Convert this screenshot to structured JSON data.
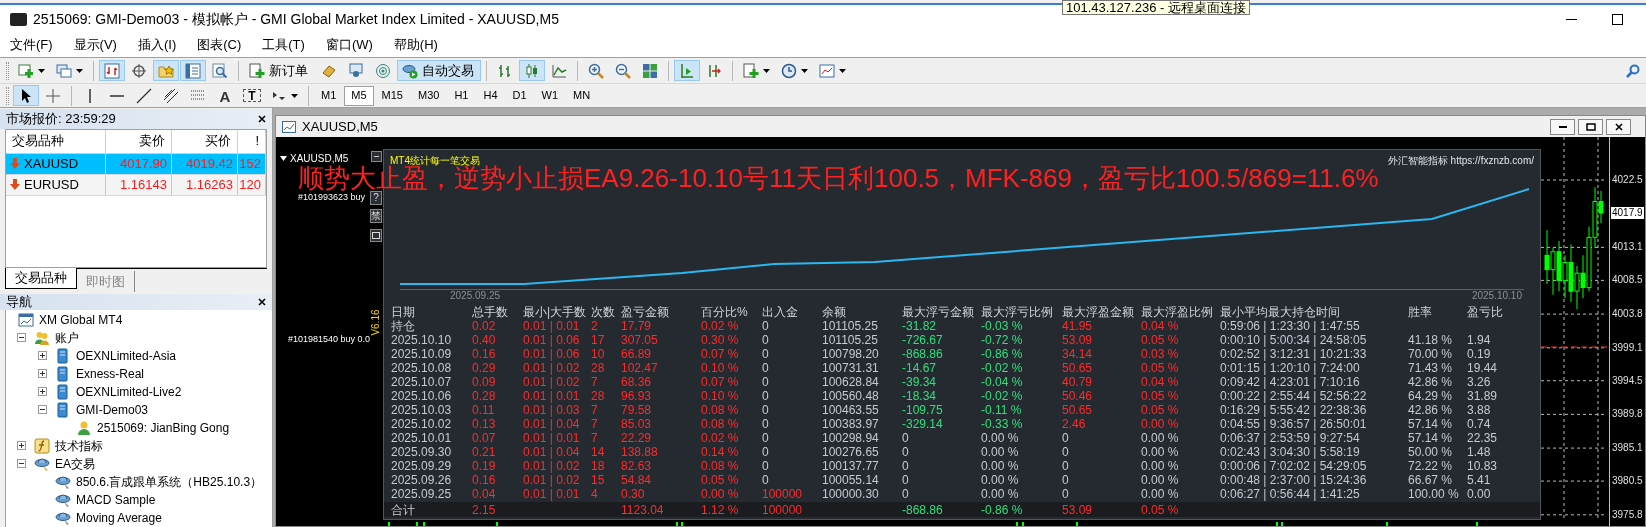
{
  "window": {
    "title": "2515069: GMI-Demo03 - 模拟帐户 - GMI Global Market Index Limited - XAUUSD,M5"
  },
  "tooltip": "101.43.127.236 - 远程桌面连接",
  "menu": [
    "文件(F)",
    "显示(V)",
    "插入(I)",
    "图表(C)",
    "工具(T)",
    "窗口(W)",
    "帮助(H)"
  ],
  "toolbars": [
    [
      {
        "kind": "new-chart",
        "pressed": false
      },
      {
        "kind": "profiles",
        "pressed": false
      },
      {
        "kind": "separator"
      },
      {
        "kind": "market-watch",
        "pressed": true
      },
      {
        "kind": "data-window",
        "pressed": false
      },
      {
        "kind": "navigator",
        "pressed": true
      },
      {
        "kind": "terminal",
        "pressed": true
      },
      {
        "kind": "tester",
        "pressed": false
      },
      {
        "kind": "separator"
      },
      {
        "kind": "order",
        "label": "新订单",
        "pressed": false
      },
      {
        "kind": "editor",
        "pressed": false
      },
      {
        "kind": "news",
        "pressed": false
      },
      {
        "kind": "signals",
        "pressed": false
      },
      {
        "kind": "autotrade",
        "label": "自动交易",
        "pressed": true
      },
      {
        "kind": "separator"
      },
      {
        "kind": "bar-chart",
        "pressed": false
      },
      {
        "kind": "candles",
        "pressed": true
      },
      {
        "kind": "line-chart",
        "pressed": false
      },
      {
        "kind": "separator"
      },
      {
        "kind": "zoom-in",
        "pressed": false
      },
      {
        "kind": "zoom-out",
        "pressed": false
      },
      {
        "kind": "tile",
        "pressed": false
      },
      {
        "kind": "separator"
      },
      {
        "kind": "autoscroll",
        "pressed": true
      },
      {
        "kind": "shift",
        "pressed": false
      },
      {
        "kind": "separator"
      },
      {
        "kind": "indicators",
        "pressed": false
      },
      {
        "kind": "periods",
        "pressed": false
      },
      {
        "kind": "templates",
        "pressed": false
      }
    ],
    [
      {
        "kind": "cursor",
        "pressed": true
      },
      {
        "kind": "crosshair",
        "pressed": false
      },
      {
        "kind": "separator"
      },
      {
        "kind": "vline",
        "pressed": false
      },
      {
        "kind": "hline",
        "pressed": false
      },
      {
        "kind": "trendline",
        "pressed": false
      },
      {
        "kind": "channel",
        "pressed": false
      },
      {
        "kind": "fibo",
        "pressed": false
      },
      {
        "kind": "text",
        "label": "A",
        "pressed": false
      },
      {
        "kind": "label",
        "label": "T",
        "pressed": false
      },
      {
        "kind": "arrows",
        "pressed": false
      },
      {
        "kind": "separator"
      },
      {
        "kind": "period",
        "label": "M1",
        "pressed": false
      },
      {
        "kind": "period",
        "label": "M5",
        "pressed": true
      },
      {
        "kind": "period",
        "label": "M15",
        "pressed": false
      },
      {
        "kind": "period",
        "label": "M30",
        "pressed": false
      },
      {
        "kind": "period",
        "label": "H1",
        "pressed": false
      },
      {
        "kind": "period",
        "label": "H4",
        "pressed": false
      },
      {
        "kind": "period",
        "label": "D1",
        "pressed": false
      },
      {
        "kind": "period",
        "label": "W1",
        "pressed": false
      },
      {
        "kind": "period",
        "label": "MN",
        "pressed": false
      }
    ]
  ],
  "market_watch": {
    "title": "市场报价: 23:59:29",
    "columns": [
      "交易品种",
      "卖价",
      "买价",
      "!"
    ],
    "rows": [
      {
        "symbol": "XAUUSD",
        "bid": "4017.90",
        "ask": "4019.42",
        "spread": "152",
        "selected": true
      },
      {
        "symbol": "EURUSD",
        "bid": "1.16143",
        "ask": "1.16263",
        "spread": "120",
        "selected": false
      }
    ],
    "tabs": [
      {
        "label": "交易品种",
        "selected": true
      },
      {
        "label": "即时图",
        "selected": false
      }
    ]
  },
  "navigator": {
    "title": "导航",
    "tree": [
      {
        "label": "XM Global MT4",
        "kind": "root",
        "children": [
          {
            "label": "账户",
            "kind": "accounts",
            "expanded": true,
            "children": [
              {
                "label": "OEXNLimited-Asia",
                "kind": "server",
                "expanded": false
              },
              {
                "label": "Exness-Real",
                "kind": "server",
                "expanded": false
              },
              {
                "label": "OEXNLimited-Live2",
                "kind": "server",
                "expanded": false
              },
              {
                "label": "GMI-Demo03",
                "kind": "server",
                "expanded": true,
                "children": [
                  {
                    "label": "2515069: JianBing Gong",
                    "kind": "user"
                  }
                ]
              }
            ]
          },
          {
            "label": "技术指标",
            "kind": "indicators",
            "expanded": false
          },
          {
            "label": "EA交易",
            "kind": "experts",
            "expanded": true,
            "children": [
              {
                "label": "850.6.盲成跟单系统（HB25.10.3）",
                "kind": "expert"
              },
              {
                "label": "MACD Sample",
                "kind": "expert"
              },
              {
                "label": "Moving Average",
                "kind": "expert"
              }
            ]
          }
        ]
      }
    ]
  },
  "chart_window": {
    "title": "XAUUSD,M5",
    "symbol_label": "XAUUSD,M5",
    "orders": [
      "#101993623 buy",
      "#101981540 buy 0.0"
    ],
    "side_buttons": [
      "?",
      "禁"
    ],
    "version": "V6.16",
    "note": "顺势大止盈，逆势小止损EA9.26-10.10号11天日利100.5，MFK-869，盈亏比100.5/869=11.6%",
    "current_price": "4017.9",
    "chart_data": {
      "type": "candlestick",
      "ohlc": [
        [
          4012.0,
          4015.5,
          4008.0,
          4010.0
        ],
        [
          4010.0,
          4013.0,
          4006.5,
          4012.5
        ],
        [
          4012.5,
          4014.0,
          4007.0,
          4008.5
        ],
        [
          4008.5,
          4012.0,
          4006.0,
          4011.0
        ],
        [
          4011.0,
          4013.5,
          4005.5,
          4007.0
        ],
        [
          4007.0,
          4010.5,
          4004.5,
          4009.5
        ],
        [
          4009.5,
          4012.0,
          4006.0,
          4007.5
        ],
        [
          4007.5,
          4016.0,
          4007.0,
          4014.5
        ],
        [
          4014.5,
          4021.5,
          4013.0,
          4019.5
        ],
        [
          4019.5,
          4021.0,
          4016.5,
          4017.9
        ]
      ],
      "ylim": [
        3974.1,
        4028.5
      ],
      "yticks": [
        {
          "value": 4022.5,
          "label": "4022.5"
        },
        {
          "value": 4013.1,
          "label": "4013.1"
        },
        {
          "value": 4008.5,
          "label": "4008.5"
        },
        {
          "value": 4003.8,
          "label": "4003.8"
        },
        {
          "value": 3999.1,
          "label": "3999.1"
        },
        {
          "value": 3994.5,
          "label": "3994.5"
        },
        {
          "value": 3989.8,
          "label": "3989.8"
        },
        {
          "value": 3985.1,
          "label": "3985.1"
        },
        {
          "value": 3980.5,
          "label": "3980.5"
        },
        {
          "value": 3975.8,
          "label": "3975.8"
        }
      ]
    }
  },
  "stats_panel": {
    "title": "MT4统计每一笔交易",
    "credit": "外汇智能指标 https://fxznzb.com/",
    "dates": [
      "2025.09.25",
      "2025.10.10"
    ],
    "columns": [
      "日期",
      "总手数",
      "最小|大手数",
      "次数",
      "盈亏金额",
      "百分比%",
      "出入金",
      "余额",
      "最大浮亏金额",
      "最大浮亏比例",
      "最大浮盈金额",
      "最大浮盈比例",
      "最小平均最大持仓时间",
      "胜率",
      "盈亏比"
    ],
    "rows": [
      [
        {
          "text": "持仓",
          "kind": "plain"
        },
        {
          "text": "0.02",
          "kind": "red"
        },
        {
          "text": "0.01 | 0.01",
          "kind": "red"
        },
        {
          "text": "2",
          "kind": "red"
        },
        {
          "text": "17.79",
          "kind": "red"
        },
        {
          "text": "0.02 %",
          "kind": "red"
        },
        {
          "text": "0",
          "kind": "plain"
        },
        {
          "text": "101105.25",
          "kind": "plain"
        },
        {
          "text": "-31.82",
          "kind": "green"
        },
        {
          "text": "-0.03 %",
          "kind": "green"
        },
        {
          "text": "41.95",
          "kind": "red"
        },
        {
          "text": "0.04 %",
          "kind": "red"
        },
        {
          "text": "0:59:06 | 1:23:30 | 1:47:55",
          "kind": "plain"
        }
      ],
      [
        {
          "text": "2025.10.10",
          "kind": "plain"
        },
        {
          "text": "0.40",
          "kind": "red"
        },
        {
          "text": "0.01 | 0.06",
          "kind": "red"
        },
        {
          "text": "17",
          "kind": "red"
        },
        {
          "text": "307.05",
          "kind": "red"
        },
        {
          "text": "0.30 %",
          "kind": "red"
        },
        {
          "text": "0",
          "kind": "plain"
        },
        {
          "text": "101105.25",
          "kind": "plain"
        },
        {
          "text": "-726.67",
          "kind": "green"
        },
        {
          "text": "-0.72 %",
          "kind": "green"
        },
        {
          "text": "53.09",
          "kind": "red"
        },
        {
          "text": "0.05 %",
          "kind": "red"
        },
        {
          "text": "0:00:10 | 5:00:34 | 24:58:05",
          "kind": "plain"
        },
        {
          "text": "41.18 %",
          "kind": "plain"
        },
        {
          "text": "1.94",
          "kind": "plain"
        }
      ],
      [
        {
          "text": "2025.10.09",
          "kind": "plain"
        },
        {
          "text": "0.16",
          "kind": "red"
        },
        {
          "text": "0.01 | 0.06",
          "kind": "red"
        },
        {
          "text": "10",
          "kind": "red"
        },
        {
          "text": "66.89",
          "kind": "red"
        },
        {
          "text": "0.07 %",
          "kind": "red"
        },
        {
          "text": "0",
          "kind": "plain"
        },
        {
          "text": "100798.20",
          "kind": "plain"
        },
        {
          "text": "-868.86",
          "kind": "green"
        },
        {
          "text": "-0.86 %",
          "kind": "green"
        },
        {
          "text": "34.14",
          "kind": "red"
        },
        {
          "text": "0.03 %",
          "kind": "red"
        },
        {
          "text": "0:02:52 | 3:12:31 | 10:21:33",
          "kind": "plain"
        },
        {
          "text": "70.00 %",
          "kind": "plain"
        },
        {
          "text": "0.19",
          "kind": "plain"
        }
      ],
      [
        {
          "text": "2025.10.08",
          "kind": "plain"
        },
        {
          "text": "0.29",
          "kind": "red"
        },
        {
          "text": "0.01 | 0.02",
          "kind": "red"
        },
        {
          "text": "28",
          "kind": "red"
        },
        {
          "text": "102.47",
          "kind": "red"
        },
        {
          "text": "0.10 %",
          "kind": "red"
        },
        {
          "text": "0",
          "kind": "plain"
        },
        {
          "text": "100731.31",
          "kind": "plain"
        },
        {
          "text": "-14.67",
          "kind": "green"
        },
        {
          "text": "-0.02 %",
          "kind": "green"
        },
        {
          "text": "50.65",
          "kind": "red"
        },
        {
          "text": "0.05 %",
          "kind": "red"
        },
        {
          "text": "0:01:15 | 1:20:10 | 7:24:00",
          "kind": "plain"
        },
        {
          "text": "71.43 %",
          "kind": "plain"
        },
        {
          "text": "19.44",
          "kind": "plain"
        }
      ],
      [
        {
          "text": "2025.10.07",
          "kind": "plain"
        },
        {
          "text": "0.09",
          "kind": "red"
        },
        {
          "text": "0.01 | 0.02",
          "kind": "red"
        },
        {
          "text": "7",
          "kind": "red"
        },
        {
          "text": "68.36",
          "kind": "red"
        },
        {
          "text": "0.07 %",
          "kind": "red"
        },
        {
          "text": "0",
          "kind": "plain"
        },
        {
          "text": "100628.84",
          "kind": "plain"
        },
        {
          "text": "-39.34",
          "kind": "green"
        },
        {
          "text": "-0.04 %",
          "kind": "green"
        },
        {
          "text": "40.79",
          "kind": "red"
        },
        {
          "text": "0.04 %",
          "kind": "red"
        },
        {
          "text": "0:09:42 | 4:23:01 | 7:10:16",
          "kind": "plain"
        },
        {
          "text": "42.86 %",
          "kind": "plain"
        },
        {
          "text": "3.26",
          "kind": "plain"
        }
      ],
      [
        {
          "text": "2025.10.06",
          "kind": "plain"
        },
        {
          "text": "0.28",
          "kind": "red"
        },
        {
          "text": "0.01 | 0.01",
          "kind": "red"
        },
        {
          "text": "28",
          "kind": "red"
        },
        {
          "text": "96.93",
          "kind": "red"
        },
        {
          "text": "0.10 %",
          "kind": "red"
        },
        {
          "text": "0",
          "kind": "plain"
        },
        {
          "text": "100560.48",
          "kind": "plain"
        },
        {
          "text": "-18.34",
          "kind": "green"
        },
        {
          "text": "-0.02 %",
          "kind": "green"
        },
        {
          "text": "50.46",
          "kind": "red"
        },
        {
          "text": "0.05 %",
          "kind": "red"
        },
        {
          "text": "0:00:22 | 2:55:44 | 52:56:22",
          "kind": "plain"
        },
        {
          "text": "64.29 %",
          "kind": "plain"
        },
        {
          "text": "31.89",
          "kind": "plain"
        }
      ],
      [
        {
          "text": "2025.10.03",
          "kind": "plain"
        },
        {
          "text": "0.11",
          "kind": "red"
        },
        {
          "text": "0.01 | 0.03",
          "kind": "red"
        },
        {
          "text": "7",
          "kind": "red"
        },
        {
          "text": "79.58",
          "kind": "red"
        },
        {
          "text": "0.08 %",
          "kind": "red"
        },
        {
          "text": "0",
          "kind": "plain"
        },
        {
          "text": "100463.55",
          "kind": "plain"
        },
        {
          "text": "-109.75",
          "kind": "green"
        },
        {
          "text": "-0.11 %",
          "kind": "green"
        },
        {
          "text": "50.65",
          "kind": "red"
        },
        {
          "text": "0.05 %",
          "kind": "red"
        },
        {
          "text": "0:16:29 | 5:55:42 | 22:38:36",
          "kind": "plain"
        },
        {
          "text": "42.86 %",
          "kind": "plain"
        },
        {
          "text": "3.88",
          "kind": "plain"
        }
      ],
      [
        {
          "text": "2025.10.02",
          "kind": "plain"
        },
        {
          "text": "0.13",
          "kind": "red"
        },
        {
          "text": "0.01 | 0.04",
          "kind": "red"
        },
        {
          "text": "7",
          "kind": "red"
        },
        {
          "text": "85.03",
          "kind": "red"
        },
        {
          "text": "0.08 %",
          "kind": "red"
        },
        {
          "text": "0",
          "kind": "plain"
        },
        {
          "text": "100383.97",
          "kind": "plain"
        },
        {
          "text": "-329.14",
          "kind": "green"
        },
        {
          "text": "-0.33 %",
          "kind": "green"
        },
        {
          "text": "2.46",
          "kind": "red"
        },
        {
          "text": "0.00 %",
          "kind": "red"
        },
        {
          "text": "0:04:55 | 9:36:57 | 26:50:01",
          "kind": "plain"
        },
        {
          "text": "57.14 %",
          "kind": "plain"
        },
        {
          "text": "0.74",
          "kind": "plain"
        }
      ],
      [
        {
          "text": "2025.10.01",
          "kind": "plain"
        },
        {
          "text": "0.07",
          "kind": "red"
        },
        {
          "text": "0.01 | 0.01",
          "kind": "red"
        },
        {
          "text": "7",
          "kind": "red"
        },
        {
          "text": "22.29",
          "kind": "red"
        },
        {
          "text": "0.02 %",
          "kind": "red"
        },
        {
          "text": "0",
          "kind": "plain"
        },
        {
          "text": "100298.94",
          "kind": "plain"
        },
        {
          "text": "0",
          "kind": "plain"
        },
        {
          "text": "0.00 %",
          "kind": "plain"
        },
        {
          "text": "0",
          "kind": "plain"
        },
        {
          "text": "0.00 %",
          "kind": "plain"
        },
        {
          "text": "0:06:37 | 2:53:59 | 9:27:54",
          "kind": "plain"
        },
        {
          "text": "57.14 %",
          "kind": "plain"
        },
        {
          "text": "22.35",
          "kind": "plain"
        }
      ],
      [
        {
          "text": "2025.09.30",
          "kind": "plain"
        },
        {
          "text": "0.21",
          "kind": "red"
        },
        {
          "text": "0.01 | 0.04",
          "kind": "red"
        },
        {
          "text": "14",
          "kind": "red"
        },
        {
          "text": "138.88",
          "kind": "red"
        },
        {
          "text": "0.14 %",
          "kind": "red"
        },
        {
          "text": "0",
          "kind": "plain"
        },
        {
          "text": "100276.65",
          "kind": "plain"
        },
        {
          "text": "0",
          "kind": "plain"
        },
        {
          "text": "0.00 %",
          "kind": "plain"
        },
        {
          "text": "0",
          "kind": "plain"
        },
        {
          "text": "0.00 %",
          "kind": "plain"
        },
        {
          "text": "0:02:43 | 3:04:30 | 5:58:19",
          "kind": "plain"
        },
        {
          "text": "50.00 %",
          "kind": "plain"
        },
        {
          "text": "1.48",
          "kind": "plain"
        }
      ],
      [
        {
          "text": "2025.09.29",
          "kind": "plain"
        },
        {
          "text": "0.19",
          "kind": "red"
        },
        {
          "text": "0.01 | 0.02",
          "kind": "red"
        },
        {
          "text": "18",
          "kind": "red"
        },
        {
          "text": "82.63",
          "kind": "red"
        },
        {
          "text": "0.08 %",
          "kind": "red"
        },
        {
          "text": "0",
          "kind": "plain"
        },
        {
          "text": "100137.77",
          "kind": "plain"
        },
        {
          "text": "0",
          "kind": "plain"
        },
        {
          "text": "0.00 %",
          "kind": "plain"
        },
        {
          "text": "0",
          "kind": "plain"
        },
        {
          "text": "0.00 %",
          "kind": "plain"
        },
        {
          "text": "0:00:06 | 7:02:02 | 54:29:05",
          "kind": "plain"
        },
        {
          "text": "72.22 %",
          "kind": "plain"
        },
        {
          "text": "10.83",
          "kind": "plain"
        }
      ],
      [
        {
          "text": "2025.09.26",
          "kind": "plain"
        },
        {
          "text": "0.16",
          "kind": "red"
        },
        {
          "text": "0.01 | 0.02",
          "kind": "red"
        },
        {
          "text": "15",
          "kind": "red"
        },
        {
          "text": "54.84",
          "kind": "red"
        },
        {
          "text": "0.05 %",
          "kind": "red"
        },
        {
          "text": "0",
          "kind": "plain"
        },
        {
          "text": "100055.14",
          "kind": "plain"
        },
        {
          "text": "0",
          "kind": "plain"
        },
        {
          "text": "0.00 %",
          "kind": "plain"
        },
        {
          "text": "0",
          "kind": "plain"
        },
        {
          "text": "0.00 %",
          "kind": "plain"
        },
        {
          "text": "0:00:48 | 2:37:00 | 15:24:36",
          "kind": "plain"
        },
        {
          "text": "66.67 %",
          "kind": "plain"
        },
        {
          "text": "5.41",
          "kind": "plain"
        }
      ],
      [
        {
          "text": "2025.09.25",
          "kind": "plain"
        },
        {
          "text": "0.04",
          "kind": "red"
        },
        {
          "text": "0.01 | 0.01",
          "kind": "red"
        },
        {
          "text": "4",
          "kind": "red"
        },
        {
          "text": "0.30",
          "kind": "red"
        },
        {
          "text": "0.00 %",
          "kind": "red"
        },
        {
          "text": "100000",
          "kind": "red"
        },
        {
          "text": "100000.30",
          "kind": "plain"
        },
        {
          "text": "0",
          "kind": "plain"
        },
        {
          "text": "0.00 %",
          "kind": "plain"
        },
        {
          "text": "0",
          "kind": "plain"
        },
        {
          "text": "0.00 %",
          "kind": "plain"
        },
        {
          "text": "0:06:27 | 0:56:44 | 1:41:25",
          "kind": "plain"
        },
        {
          "text": "100.00 %",
          "kind": "plain"
        },
        {
          "text": "0.00",
          "kind": "plain"
        }
      ]
    ],
    "total": [
      {
        "text": "合计",
        "kind": "plain"
      },
      {
        "text": "2.15",
        "kind": "red"
      },
      {
        "kind": "blank"
      },
      {
        "kind": "blank"
      },
      {
        "text": "1123.04",
        "kind": "red"
      },
      {
        "text": "1.12 %",
        "kind": "red"
      },
      {
        "text": "100000",
        "kind": "red"
      },
      {
        "kind": "blank"
      },
      {
        "text": "-868.86",
        "kind": "green"
      },
      {
        "text": "-0.86 %",
        "kind": "green"
      },
      {
        "text": "53.09",
        "kind": "red"
      },
      {
        "text": "0.05 %",
        "kind": "red"
      }
    ]
  }
}
